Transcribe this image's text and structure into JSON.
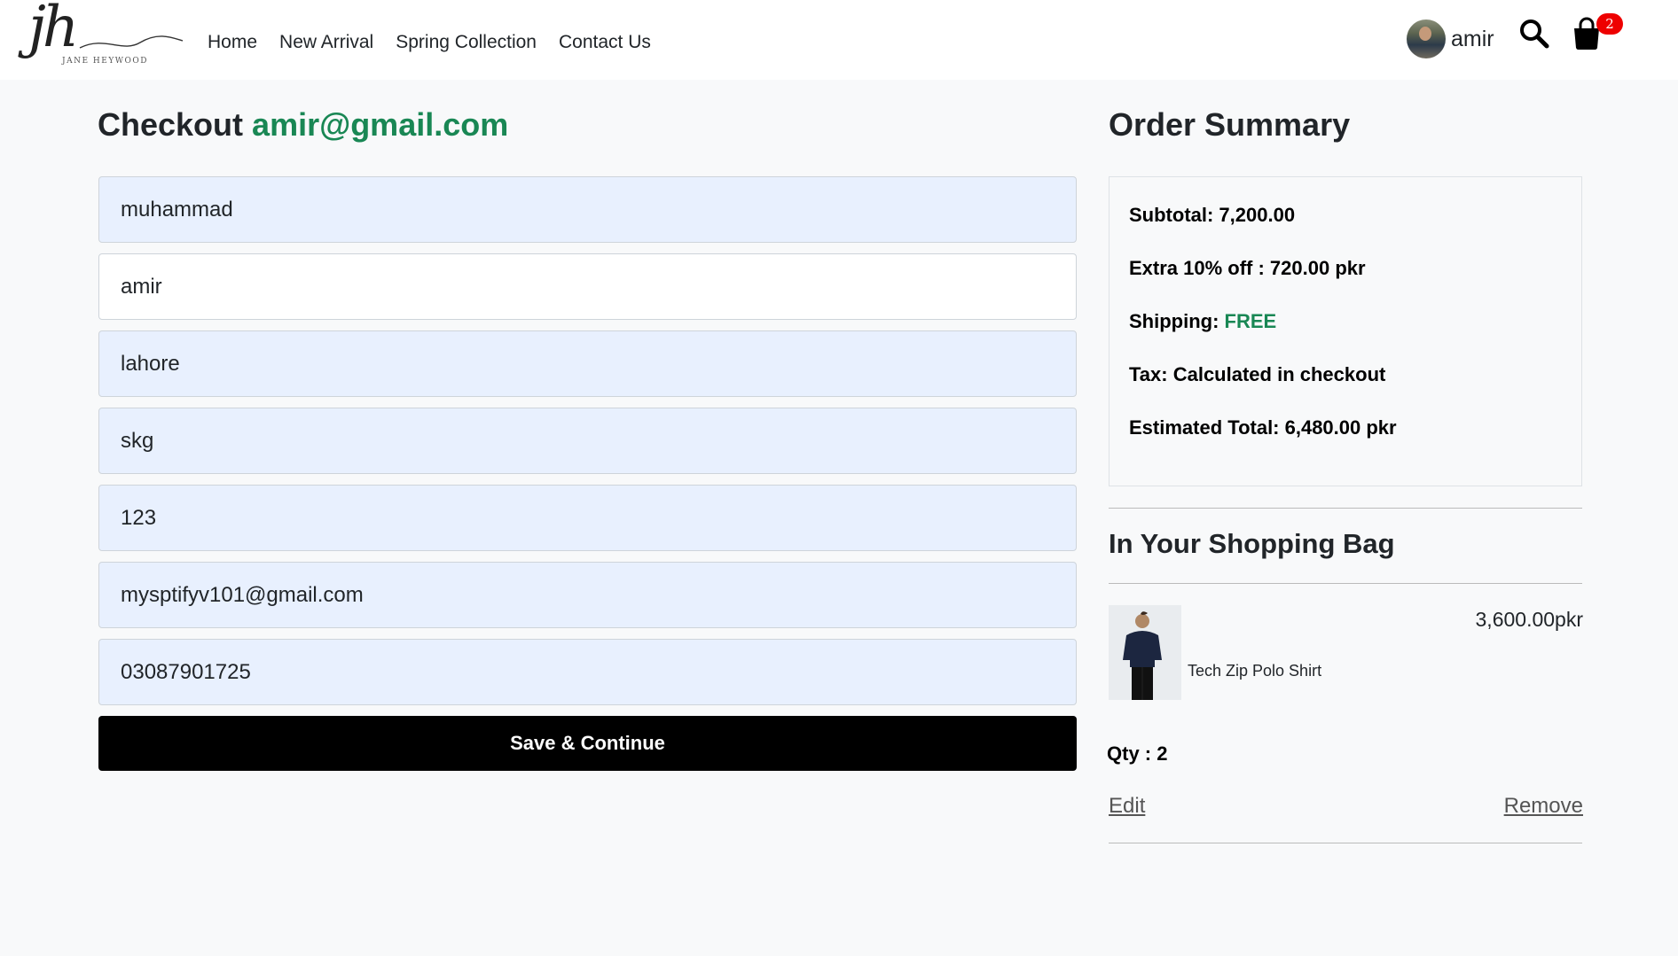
{
  "brand": {
    "logo_text": "jh",
    "logo_subtext": "JANE HEYWOOD"
  },
  "nav": {
    "links": [
      "Home",
      "New Arrival",
      "Spring Collection",
      "Contact Us"
    ]
  },
  "user": {
    "name": "amir"
  },
  "cart": {
    "count": "2"
  },
  "icons": {
    "search": "search-icon",
    "cart": "shopping-bag-icon"
  },
  "checkout": {
    "title": "Checkout",
    "email": "amir@gmail.com",
    "fields": {
      "first_name": "muhammad",
      "last_name": "amir",
      "city": "lahore",
      "address": "skg",
      "postal_code": "123",
      "email": "mysptifyv101@gmail.com",
      "phone": "03087901725"
    },
    "save_label": "Save & Continue"
  },
  "summary": {
    "title": "Order Summary",
    "subtotal": "Subtotal: 7,200.00",
    "discount": "Extra 10% off : 720.00 pkr",
    "shipping_label": "Shipping:",
    "shipping_value": "FREE",
    "tax": "Tax: Calculated in checkout",
    "total": "Estimated Total: 6,480.00 pkr"
  },
  "bag": {
    "title": "In Your Shopping Bag",
    "item": {
      "name": "Tech Zip Polo Shirt",
      "price": "3,600.00pkr",
      "qty": "Qty : 2",
      "edit": "Edit",
      "remove": "Remove"
    }
  },
  "colors": {
    "accent_green": "#198754",
    "badge_red": "#e00000",
    "input_fill": "#e8f0fe"
  }
}
